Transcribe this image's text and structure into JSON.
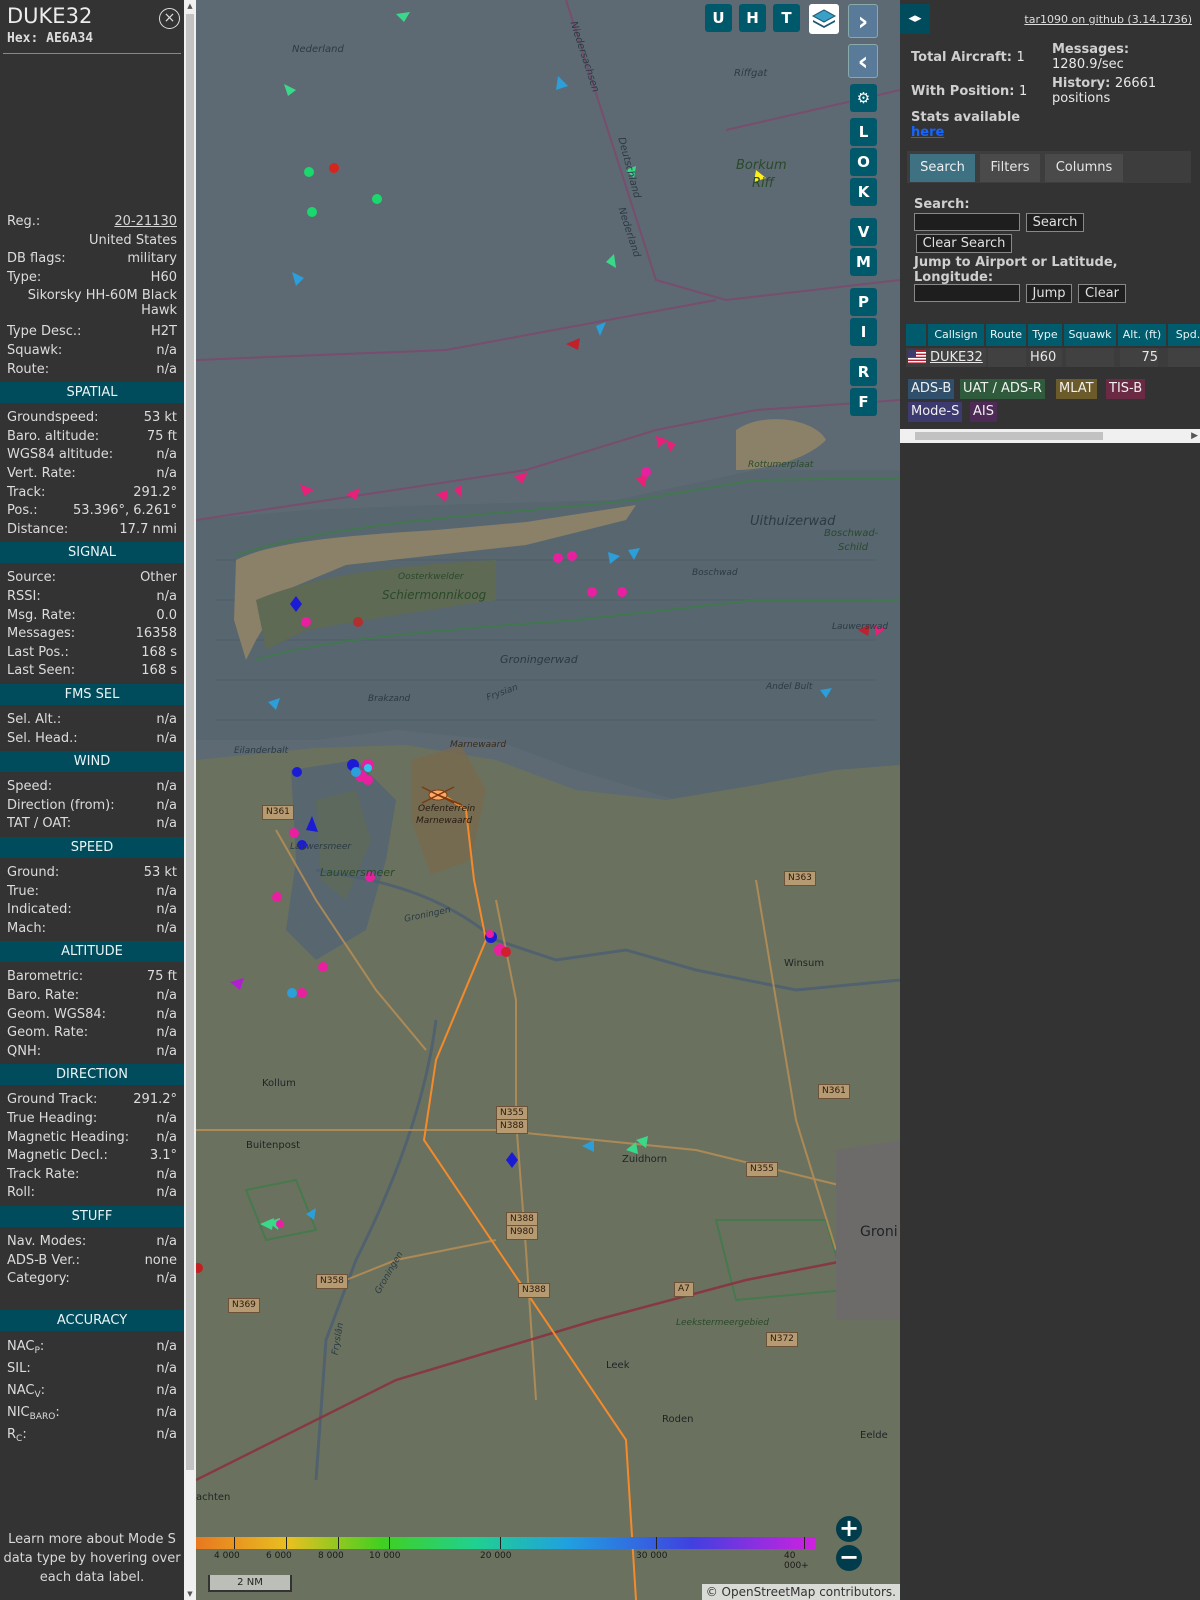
{
  "aircraft": {
    "callsign": "DUKE32",
    "hex": "Hex: AE6A34",
    "close_icon": "×",
    "rows_top": [
      {
        "k": "Reg.:",
        "v": "20-21130",
        "link": true
      },
      {
        "k": "",
        "v": "United States"
      },
      {
        "k": "DB flags:",
        "v": "military"
      },
      {
        "k": "Type:",
        "v": "H60"
      },
      {
        "k": "",
        "v": "Sikorsky HH-60M Black Hawk",
        "wrap": true
      },
      {
        "k": "Type Desc.:",
        "v": "H2T"
      },
      {
        "k": "Squawk:",
        "v": "n/a"
      },
      {
        "k": "Route:",
        "v": "n/a"
      }
    ],
    "sections": [
      {
        "title": "SPATIAL",
        "rows": [
          {
            "k": "Groundspeed:",
            "v": "53 kt"
          },
          {
            "k": "Baro. altitude:",
            "v": "75 ft"
          },
          {
            "k": "WGS84 altitude:",
            "v": "n/a"
          },
          {
            "k": "Vert. Rate:",
            "v": "n/a"
          },
          {
            "k": "Track:",
            "v": "291.2°"
          },
          {
            "k": "Pos.:",
            "v": "53.396°, 6.261°"
          },
          {
            "k": "Distance:",
            "v": "17.7 nmi"
          }
        ]
      },
      {
        "title": "SIGNAL",
        "rows": [
          {
            "k": "Source:",
            "v": "Other"
          },
          {
            "k": "RSSI:",
            "v": "n/a"
          },
          {
            "k": "Msg. Rate:",
            "v": "0.0"
          },
          {
            "k": "Messages:",
            "v": "16358"
          },
          {
            "k": "Last Pos.:",
            "v": "168 s"
          },
          {
            "k": "Last Seen:",
            "v": "168 s"
          }
        ]
      },
      {
        "title": "FMS SEL",
        "rows": [
          {
            "k": "Sel. Alt.:",
            "v": "n/a"
          },
          {
            "k": "Sel. Head.:",
            "v": "n/a"
          }
        ]
      },
      {
        "title": "WIND",
        "rows": [
          {
            "k": "Speed:",
            "v": "n/a"
          },
          {
            "k": "Direction (from):",
            "v": "n/a"
          },
          {
            "k": "TAT / OAT:",
            "v": "n/a"
          }
        ]
      },
      {
        "title": "SPEED",
        "rows": [
          {
            "k": "Ground:",
            "v": "53 kt"
          },
          {
            "k": "True:",
            "v": "n/a"
          },
          {
            "k": "Indicated:",
            "v": "n/a"
          },
          {
            "k": "Mach:",
            "v": "n/a"
          }
        ]
      },
      {
        "title": "ALTITUDE",
        "rows": [
          {
            "k": "Barometric:",
            "v": "75 ft"
          },
          {
            "k": "Baro. Rate:",
            "v": "n/a"
          },
          {
            "k": "Geom. WGS84:",
            "v": "n/a"
          },
          {
            "k": "Geom. Rate:",
            "v": "n/a"
          },
          {
            "k": "QNH:",
            "v": "n/a"
          }
        ]
      },
      {
        "title": "DIRECTION",
        "rows": [
          {
            "k": "Ground Track:",
            "v": "291.2°"
          },
          {
            "k": "True Heading:",
            "v": "n/a"
          },
          {
            "k": "Magnetic Heading:",
            "v": "n/a"
          },
          {
            "k": "Magnetic Decl.:",
            "v": "3.1°"
          },
          {
            "k": "Track Rate:",
            "v": "n/a"
          },
          {
            "k": "Roll:",
            "v": "n/a"
          }
        ]
      },
      {
        "title": "STUFF",
        "rows": [
          {
            "k": "Nav. Modes:",
            "v": "n/a"
          },
          {
            "k": "ADS-B Ver.:",
            "v": "none"
          },
          {
            "k": "Category:",
            "v": "n/a"
          }
        ]
      }
    ],
    "accuracy_title": "ACCURACY",
    "accuracy": [
      {
        "k": "NAC",
        "sub": "P",
        "v": "n/a"
      },
      {
        "k": "SIL",
        "sub": "",
        "v": "n/a"
      },
      {
        "k": "NAC",
        "sub": "V",
        "v": "n/a"
      },
      {
        "k": "NIC",
        "sub": "BARO",
        "v": "n/a"
      },
      {
        "k": "R",
        "sub": "C",
        "v": "n/a"
      }
    ],
    "footer": "Learn more about Mode S data type by hovering over each data label."
  },
  "map": {
    "buttons_top": [
      "U",
      "H",
      "T"
    ],
    "buttons_side": [
      "L",
      "O",
      "K",
      "V",
      "M",
      "P",
      "I",
      "R",
      "F"
    ],
    "nav_next": "›",
    "nav_prev": "‹",
    "labels": [
      {
        "t": "Nederland"
      },
      {
        "t": "Niedersachsen"
      },
      {
        "t": "Riffgat"
      },
      {
        "t": "Borkum"
      },
      {
        "t": "Riff"
      },
      {
        "t": "Deutschland"
      },
      {
        "t": "Nederland"
      },
      {
        "t": "Rottumerplaat"
      },
      {
        "t": "Uithuizerwad"
      },
      {
        "t": "Boschwad-"
      },
      {
        "t": "Schild"
      },
      {
        "t": "Boschwad"
      },
      {
        "t": "Oosterkwelder"
      },
      {
        "t": "Schiermonnikoog"
      },
      {
        "t": "Groningerwad"
      },
      {
        "t": "Lauwerswad"
      },
      {
        "t": "Brakzand"
      },
      {
        "t": "Frysian"
      },
      {
        "t": "Andel Bult"
      },
      {
        "t": "Eilanderbalt"
      },
      {
        "t": "Marnewaard"
      },
      {
        "t": "Oefenterrein"
      },
      {
        "t": "Marnewaard"
      },
      {
        "t": "Lauwersmeer"
      },
      {
        "t": "Lauwersmeer"
      },
      {
        "t": "Groningen"
      },
      {
        "t": "Leekstermeergebied"
      },
      {
        "t": "Groningen"
      },
      {
        "t": "Fryslân"
      }
    ],
    "towns": [
      "Winsum",
      "Kollum",
      "Buitenpost",
      "Zuidhorn",
      "Leek",
      "Roden",
      "Groni",
      "Eelde",
      "achten"
    ],
    "roads": [
      "N361",
      "N363",
      "N361",
      "N355",
      "N388",
      "N355",
      "N388",
      "N980",
      "N358",
      "N369",
      "N388",
      "A7",
      "N372"
    ],
    "colorbar_ticks": [
      "4 000",
      "6 000",
      "8 000",
      "10 000",
      "20 000",
      "30 000",
      "40 000+"
    ],
    "scale": "2 NM",
    "attribution": "© OpenStreetMap contributors.",
    "zoom_in": "+",
    "zoom_out": "−"
  },
  "sidebar": {
    "toggle": "◂▸",
    "github": "tar1090 on github (3.14.1736)",
    "total_label": "Total Aircraft:",
    "total": "1",
    "pos_label": "With Position:",
    "pos": "1",
    "msg_label": "Messages:",
    "msg": "1280.9/sec",
    "hist_label": "History:",
    "hist": "26661 positions",
    "stats_label": "Stats available",
    "stats_link": "here",
    "tabs": [
      "Search",
      "Filters",
      "Columns"
    ],
    "search_label": "Search:",
    "search_btn": "Search",
    "clear_search_btn": "Clear Search",
    "jump_label": "Jump to Airport or Latitude, Longitude:",
    "jump_btn": "Jump",
    "clear_btn": "Clear",
    "table_headers": [
      "",
      "Callsign",
      "Route",
      "Type",
      "Squawk",
      "Alt. (ft)",
      "Spd."
    ],
    "table_row": {
      "callsign": "DUKE32",
      "route": "",
      "type": "H60",
      "squawk": "",
      "alt": "75",
      "spd": ""
    },
    "sources": [
      {
        "t": "ADS-B",
        "c": "#2f4f6a"
      },
      {
        "t": "UAT / ADS-R",
        "c": "#2f5a3c"
      },
      {
        "t": "MLAT",
        "c": "#6b5a2a"
      },
      {
        "t": "TIS-B",
        "c": "#6a2a44"
      },
      {
        "t": "Mode-S",
        "c": "#3c3a6e"
      },
      {
        "t": "AIS",
        "c": "#4e2a56"
      }
    ]
  }
}
